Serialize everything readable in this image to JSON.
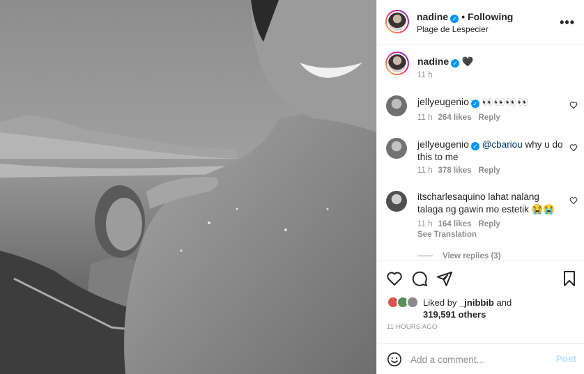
{
  "post": {
    "author": "nadine",
    "separator": "•",
    "follow_status": "Following",
    "location": "Plage de Lespecier",
    "more_label": "•••",
    "verified_glyph": "✓"
  },
  "caption": {
    "author": "nadine",
    "text": "🖤",
    "time": "11 h"
  },
  "comments": [
    {
      "user": "jellyeugenio",
      "text": "👀👀👀👀",
      "time": "11 h",
      "likes": "264 likes",
      "reply": "Reply",
      "avatar_icon": "user-avatar"
    },
    {
      "user": "jellyeugenio",
      "mention": "@cbariou",
      "text": " why u do this to me",
      "time": "11 h",
      "likes": "378 likes",
      "reply": "Reply",
      "avatar_icon": "user-avatar"
    },
    {
      "user": "itscharlesaquino",
      "text": " lahat nalang talaga ng gawin mo estetik 😭😭",
      "time": "11 h",
      "likes": "164 likes",
      "reply": "Reply",
      "see_translation": "See Translation",
      "view_replies": "View replies (3)",
      "avatar_icon": "user-avatar"
    }
  ],
  "likes": {
    "prefix": "Liked by ",
    "user": "_jnibbib",
    "and": " and",
    "count": "319,591 others"
  },
  "timestamp": "11 HOURS AGO",
  "composer": {
    "placeholder": "Add a comment...",
    "post_label": "Post"
  },
  "icons": {
    "like": "heart-icon",
    "comment": "comment-icon",
    "share": "share-icon",
    "save": "bookmark-icon",
    "emoji": "emoji-icon",
    "more": "more-icon"
  },
  "colors": {
    "verified": "#0095f6",
    "post_disabled": "#b2dffc",
    "muted": "#8e8e8e"
  }
}
